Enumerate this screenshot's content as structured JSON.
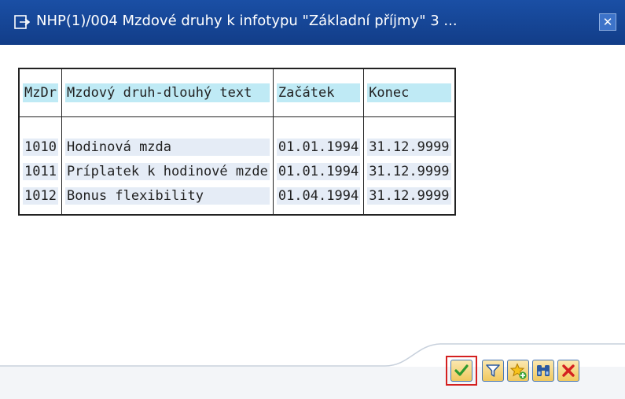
{
  "window": {
    "title": "NHP(1)/004 Mzdové druhy k infotypu \"Základní příjmy\" 3 ...",
    "close_label": "✕"
  },
  "table": {
    "headers": [
      "MzDr",
      "Mzdový druh-dlouhý text",
      "Začátek",
      "Konec"
    ],
    "rows": [
      [
        "1010",
        "Hodinová mzda",
        "01.01.1994",
        "31.12.9999"
      ],
      [
        "1011",
        "Príplatek k hodinové mzde",
        "01.01.1994",
        "31.12.9999"
      ],
      [
        "1012",
        "Bonus flexibility",
        "01.04.1994",
        "31.12.9999"
      ]
    ]
  },
  "toolbar": {
    "buttons": [
      {
        "name": "ok-button",
        "icon": "checkmark-icon"
      },
      {
        "name": "filter-button",
        "icon": "filter-icon"
      },
      {
        "name": "add-favorite-button",
        "icon": "star-plus-icon"
      },
      {
        "name": "find-button",
        "icon": "binoculars-icon"
      },
      {
        "name": "cancel-button",
        "icon": "close-icon"
      }
    ]
  },
  "colors": {
    "titlebar": "#1a4fa5",
    "header_highlight": "#bfeaf5",
    "row_highlight": "#e5ecf6",
    "accent_ok_frame": "#d42020"
  }
}
